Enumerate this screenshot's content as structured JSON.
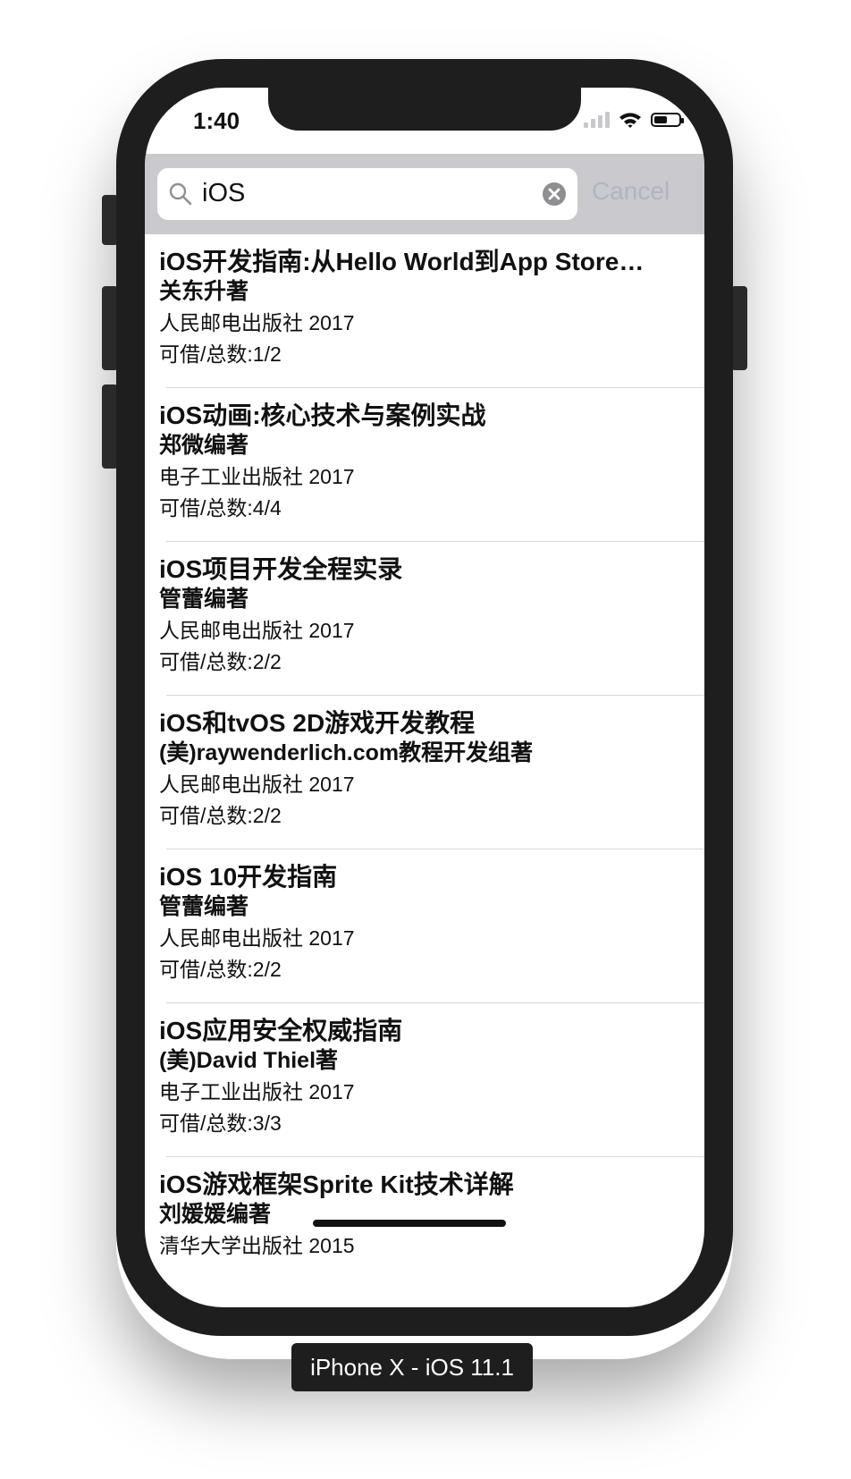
{
  "status_bar": {
    "time": "1:40"
  },
  "search": {
    "query": "iOS",
    "cancel_label": "Cancel"
  },
  "books": [
    {
      "title": "iOS开发指南:从Hello World到App Store…",
      "author": "关东升著",
      "publisher": "人民邮电出版社 2017",
      "availability": "可借/总数:1/2"
    },
    {
      "title": "iOS动画:核心技术与案例实战",
      "author": "郑微编著",
      "publisher": "电子工业出版社 2017",
      "availability": "可借/总数:4/4"
    },
    {
      "title": "iOS项目开发全程实录",
      "author": "管蕾编著",
      "publisher": "人民邮电出版社 2017",
      "availability": "可借/总数:2/2"
    },
    {
      "title": "iOS和tvOS 2D游戏开发教程",
      "author": "(美)raywenderlich.com教程开发组著",
      "publisher": "人民邮电出版社 2017",
      "availability": "可借/总数:2/2"
    },
    {
      "title": "iOS 10开发指南",
      "author": "管蕾编著",
      "publisher": "人民邮电出版社 2017",
      "availability": "可借/总数:2/2"
    },
    {
      "title": "iOS应用安全权威指南",
      "author": "(美)David Thiel著",
      "publisher": "电子工业出版社 2017",
      "availability": "可借/总数:3/3"
    },
    {
      "title": "iOS游戏框架Sprite Kit技术详解",
      "author": "刘媛媛编著",
      "publisher": "清华大学出版社 2015",
      "availability": ""
    }
  ],
  "device_label": "iPhone X - iOS 11.1",
  "icons": {
    "search": "magnifier-icon",
    "clear": "clear-circle-icon",
    "signal": "cellular-signal-icon",
    "wifi": "wifi-icon",
    "battery": "battery-icon"
  },
  "battery_level": 0.55
}
